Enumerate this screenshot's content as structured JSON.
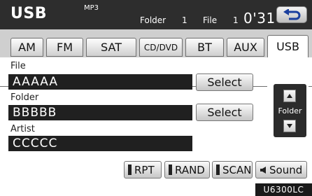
{
  "header": {
    "source": "USB",
    "format": "MP3",
    "folder_label": "Folder",
    "folder_value": "1",
    "file_label": "File",
    "file_value": "1",
    "time": "0'31\"",
    "back_icon": "return-arrow-icon"
  },
  "tabs": [
    {
      "label": "AM",
      "active": false
    },
    {
      "label": "FM",
      "active": false
    },
    {
      "label": "SAT",
      "active": false
    },
    {
      "label": "CD/DVD",
      "active": false
    },
    {
      "label": "BT",
      "active": false
    },
    {
      "label": "AUX",
      "active": false
    },
    {
      "label": "USB",
      "active": true
    }
  ],
  "info": {
    "file_label": "File",
    "file_value": "AAAAA",
    "folder_label": "Folder",
    "folder_value": "BBBBB",
    "artist_label": "Artist",
    "artist_value": "CCCCC",
    "select_label": "Select"
  },
  "folder_nav": {
    "label": "Folder",
    "up_icon": "triangle-up-icon",
    "down_icon": "triangle-down-icon"
  },
  "controls": {
    "rpt": "RPT",
    "rand": "RAND",
    "scan": "SCAN",
    "sound": "Sound",
    "sound_icon": "speaker-icon"
  },
  "figure_code": "U6300LC"
}
